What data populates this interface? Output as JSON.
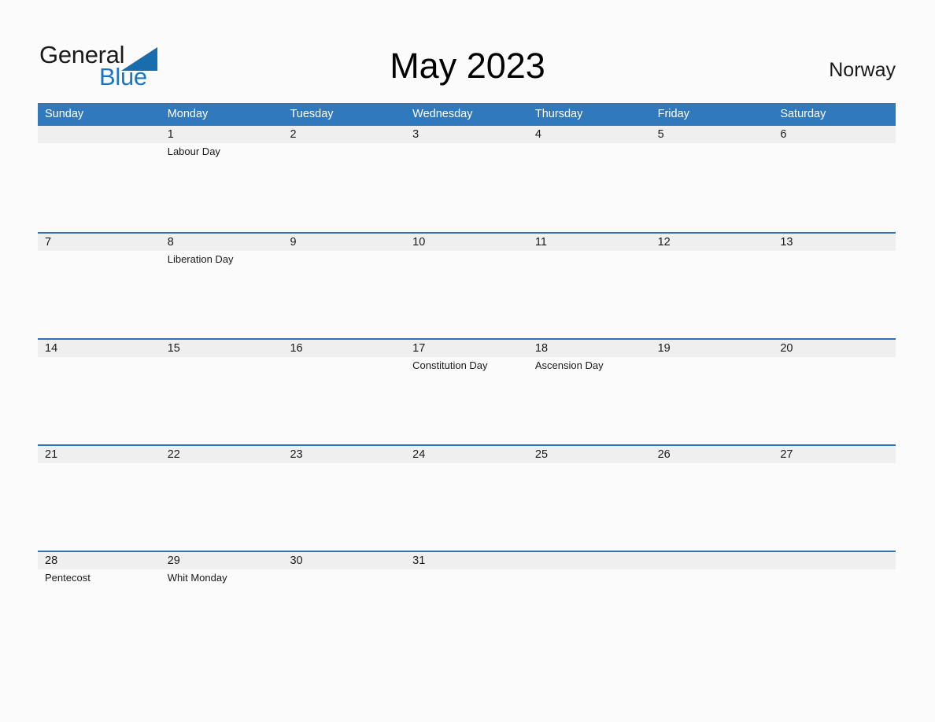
{
  "brand": {
    "name_part1": "General",
    "name_part2": "Blue",
    "triangle_icon": "triangle-icon",
    "accent_blue": "#1a76c4",
    "triangle_blue": "#1a6dad"
  },
  "header": {
    "title": "May 2023",
    "country": "Norway"
  },
  "colors": {
    "header_bar": "#3079bd",
    "row_divider": "#2e73b5",
    "date_band": "#efefef",
    "page_background": "#fbfbfb",
    "text": "#1a1a1a"
  },
  "calendar": {
    "weekdays": [
      "Sunday",
      "Monday",
      "Tuesday",
      "Wednesday",
      "Thursday",
      "Friday",
      "Saturday"
    ],
    "weeks": [
      {
        "days": [
          {
            "num": "",
            "events": []
          },
          {
            "num": "1",
            "events": [
              "Labour Day"
            ]
          },
          {
            "num": "2",
            "events": []
          },
          {
            "num": "3",
            "events": []
          },
          {
            "num": "4",
            "events": []
          },
          {
            "num": "5",
            "events": []
          },
          {
            "num": "6",
            "events": []
          }
        ]
      },
      {
        "days": [
          {
            "num": "7",
            "events": []
          },
          {
            "num": "8",
            "events": [
              "Liberation Day"
            ]
          },
          {
            "num": "9",
            "events": []
          },
          {
            "num": "10",
            "events": []
          },
          {
            "num": "11",
            "events": []
          },
          {
            "num": "12",
            "events": []
          },
          {
            "num": "13",
            "events": []
          }
        ]
      },
      {
        "days": [
          {
            "num": "14",
            "events": []
          },
          {
            "num": "15",
            "events": []
          },
          {
            "num": "16",
            "events": []
          },
          {
            "num": "17",
            "events": [
              "Constitution Day"
            ]
          },
          {
            "num": "18",
            "events": [
              "Ascension Day"
            ]
          },
          {
            "num": "19",
            "events": []
          },
          {
            "num": "20",
            "events": []
          }
        ]
      },
      {
        "days": [
          {
            "num": "21",
            "events": []
          },
          {
            "num": "22",
            "events": []
          },
          {
            "num": "23",
            "events": []
          },
          {
            "num": "24",
            "events": []
          },
          {
            "num": "25",
            "events": []
          },
          {
            "num": "26",
            "events": []
          },
          {
            "num": "27",
            "events": []
          }
        ]
      },
      {
        "days": [
          {
            "num": "28",
            "events": [
              "Pentecost"
            ]
          },
          {
            "num": "29",
            "events": [
              "Whit Monday"
            ]
          },
          {
            "num": "30",
            "events": []
          },
          {
            "num": "31",
            "events": []
          },
          {
            "num": "",
            "events": []
          },
          {
            "num": "",
            "events": []
          },
          {
            "num": "",
            "events": []
          }
        ]
      }
    ]
  }
}
